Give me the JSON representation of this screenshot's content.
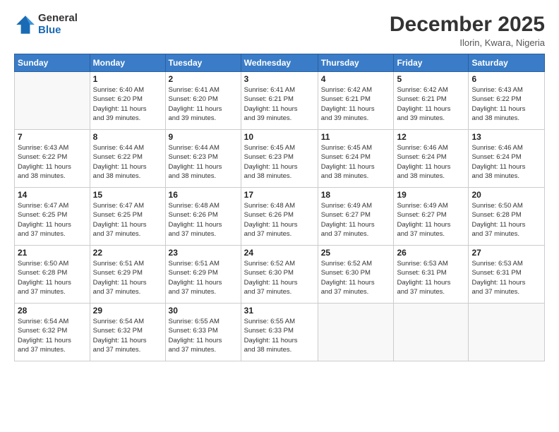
{
  "header": {
    "logo_line1": "General",
    "logo_line2": "Blue",
    "month": "December 2025",
    "location": "Ilorin, Kwara, Nigeria"
  },
  "weekdays": [
    "Sunday",
    "Monday",
    "Tuesday",
    "Wednesday",
    "Thursday",
    "Friday",
    "Saturday"
  ],
  "weeks": [
    [
      {
        "day": "",
        "info": ""
      },
      {
        "day": "1",
        "info": "Sunrise: 6:40 AM\nSunset: 6:20 PM\nDaylight: 11 hours\nand 39 minutes."
      },
      {
        "day": "2",
        "info": "Sunrise: 6:41 AM\nSunset: 6:20 PM\nDaylight: 11 hours\nand 39 minutes."
      },
      {
        "day": "3",
        "info": "Sunrise: 6:41 AM\nSunset: 6:21 PM\nDaylight: 11 hours\nand 39 minutes."
      },
      {
        "day": "4",
        "info": "Sunrise: 6:42 AM\nSunset: 6:21 PM\nDaylight: 11 hours\nand 39 minutes."
      },
      {
        "day": "5",
        "info": "Sunrise: 6:42 AM\nSunset: 6:21 PM\nDaylight: 11 hours\nand 39 minutes."
      },
      {
        "day": "6",
        "info": "Sunrise: 6:43 AM\nSunset: 6:22 PM\nDaylight: 11 hours\nand 38 minutes."
      }
    ],
    [
      {
        "day": "7",
        "info": "Sunrise: 6:43 AM\nSunset: 6:22 PM\nDaylight: 11 hours\nand 38 minutes."
      },
      {
        "day": "8",
        "info": "Sunrise: 6:44 AM\nSunset: 6:22 PM\nDaylight: 11 hours\nand 38 minutes."
      },
      {
        "day": "9",
        "info": "Sunrise: 6:44 AM\nSunset: 6:23 PM\nDaylight: 11 hours\nand 38 minutes."
      },
      {
        "day": "10",
        "info": "Sunrise: 6:45 AM\nSunset: 6:23 PM\nDaylight: 11 hours\nand 38 minutes."
      },
      {
        "day": "11",
        "info": "Sunrise: 6:45 AM\nSunset: 6:24 PM\nDaylight: 11 hours\nand 38 minutes."
      },
      {
        "day": "12",
        "info": "Sunrise: 6:46 AM\nSunset: 6:24 PM\nDaylight: 11 hours\nand 38 minutes."
      },
      {
        "day": "13",
        "info": "Sunrise: 6:46 AM\nSunset: 6:24 PM\nDaylight: 11 hours\nand 38 minutes."
      }
    ],
    [
      {
        "day": "14",
        "info": "Sunrise: 6:47 AM\nSunset: 6:25 PM\nDaylight: 11 hours\nand 37 minutes."
      },
      {
        "day": "15",
        "info": "Sunrise: 6:47 AM\nSunset: 6:25 PM\nDaylight: 11 hours\nand 37 minutes."
      },
      {
        "day": "16",
        "info": "Sunrise: 6:48 AM\nSunset: 6:26 PM\nDaylight: 11 hours\nand 37 minutes."
      },
      {
        "day": "17",
        "info": "Sunrise: 6:48 AM\nSunset: 6:26 PM\nDaylight: 11 hours\nand 37 minutes."
      },
      {
        "day": "18",
        "info": "Sunrise: 6:49 AM\nSunset: 6:27 PM\nDaylight: 11 hours\nand 37 minutes."
      },
      {
        "day": "19",
        "info": "Sunrise: 6:49 AM\nSunset: 6:27 PM\nDaylight: 11 hours\nand 37 minutes."
      },
      {
        "day": "20",
        "info": "Sunrise: 6:50 AM\nSunset: 6:28 PM\nDaylight: 11 hours\nand 37 minutes."
      }
    ],
    [
      {
        "day": "21",
        "info": "Sunrise: 6:50 AM\nSunset: 6:28 PM\nDaylight: 11 hours\nand 37 minutes."
      },
      {
        "day": "22",
        "info": "Sunrise: 6:51 AM\nSunset: 6:29 PM\nDaylight: 11 hours\nand 37 minutes."
      },
      {
        "day": "23",
        "info": "Sunrise: 6:51 AM\nSunset: 6:29 PM\nDaylight: 11 hours\nand 37 minutes."
      },
      {
        "day": "24",
        "info": "Sunrise: 6:52 AM\nSunset: 6:30 PM\nDaylight: 11 hours\nand 37 minutes."
      },
      {
        "day": "25",
        "info": "Sunrise: 6:52 AM\nSunset: 6:30 PM\nDaylight: 11 hours\nand 37 minutes."
      },
      {
        "day": "26",
        "info": "Sunrise: 6:53 AM\nSunset: 6:31 PM\nDaylight: 11 hours\nand 37 minutes."
      },
      {
        "day": "27",
        "info": "Sunrise: 6:53 AM\nSunset: 6:31 PM\nDaylight: 11 hours\nand 37 minutes."
      }
    ],
    [
      {
        "day": "28",
        "info": "Sunrise: 6:54 AM\nSunset: 6:32 PM\nDaylight: 11 hours\nand 37 minutes."
      },
      {
        "day": "29",
        "info": "Sunrise: 6:54 AM\nSunset: 6:32 PM\nDaylight: 11 hours\nand 37 minutes."
      },
      {
        "day": "30",
        "info": "Sunrise: 6:55 AM\nSunset: 6:33 PM\nDaylight: 11 hours\nand 37 minutes."
      },
      {
        "day": "31",
        "info": "Sunrise: 6:55 AM\nSunset: 6:33 PM\nDaylight: 11 hours\nand 38 minutes."
      },
      {
        "day": "",
        "info": ""
      },
      {
        "day": "",
        "info": ""
      },
      {
        "day": "",
        "info": ""
      }
    ]
  ]
}
